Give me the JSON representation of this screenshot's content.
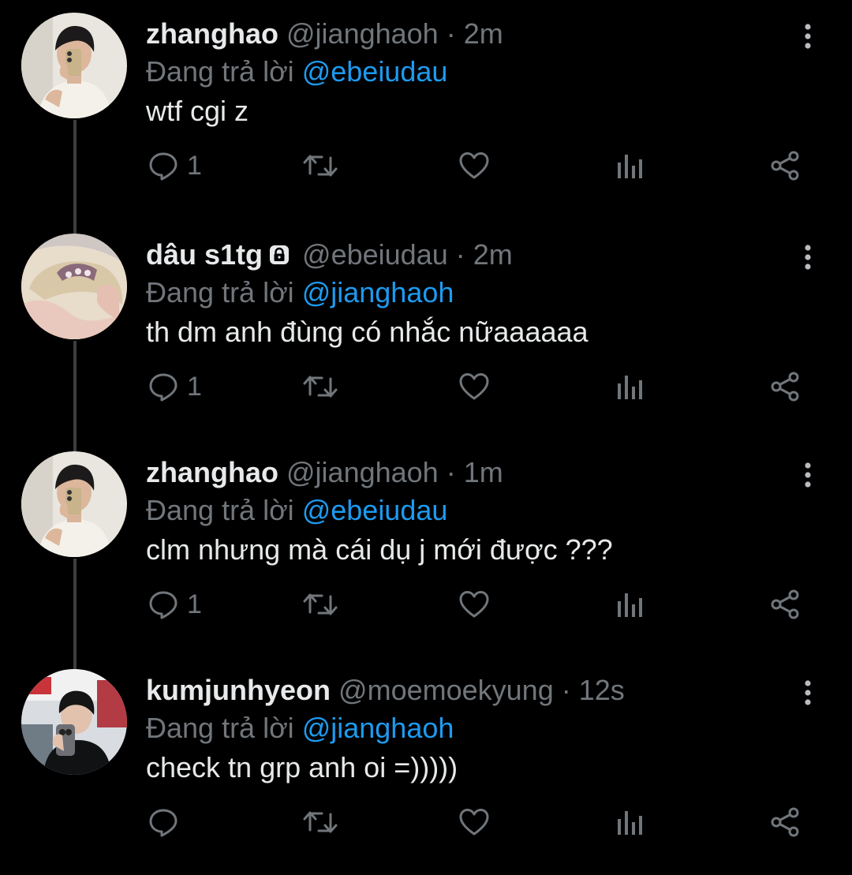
{
  "replying_prefix": "Đang trả lời",
  "tweets": [
    {
      "name": "zhanghao",
      "handle": "@jianghaoh",
      "time": "2m",
      "locked": false,
      "reply_to": "@ebeiudau",
      "text": "wtf cgi z",
      "reply_count": "1",
      "avatar": "selfie-phone"
    },
    {
      "name": "dâu s1tg",
      "handle": "@ebeiudau",
      "time": "2m",
      "locked": true,
      "reply_to": "@jianghaoh",
      "text": "th dm anh đùng có nhắc nữaaaaaa",
      "reply_count": "1",
      "avatar": "hair-clip"
    },
    {
      "name": "zhanghao",
      "handle": "@jianghaoh",
      "time": "1m",
      "locked": false,
      "reply_to": "@ebeiudau",
      "text": "clm nhưng mà cái dụ j mới được ???",
      "reply_count": "1",
      "avatar": "selfie-phone"
    },
    {
      "name": "kumjunhyeon",
      "handle": "@moemoekyung",
      "time": "12s",
      "locked": false,
      "reply_to": "@jianghaoh",
      "text": "check tn grp anh oi =)))))",
      "reply_count": "",
      "avatar": "store-selfie"
    }
  ],
  "colors": {
    "background": "#000000",
    "text": "#e7e9ea",
    "muted": "#71767b",
    "link": "#1d9bf0",
    "thread_line": "#3a3d40"
  }
}
